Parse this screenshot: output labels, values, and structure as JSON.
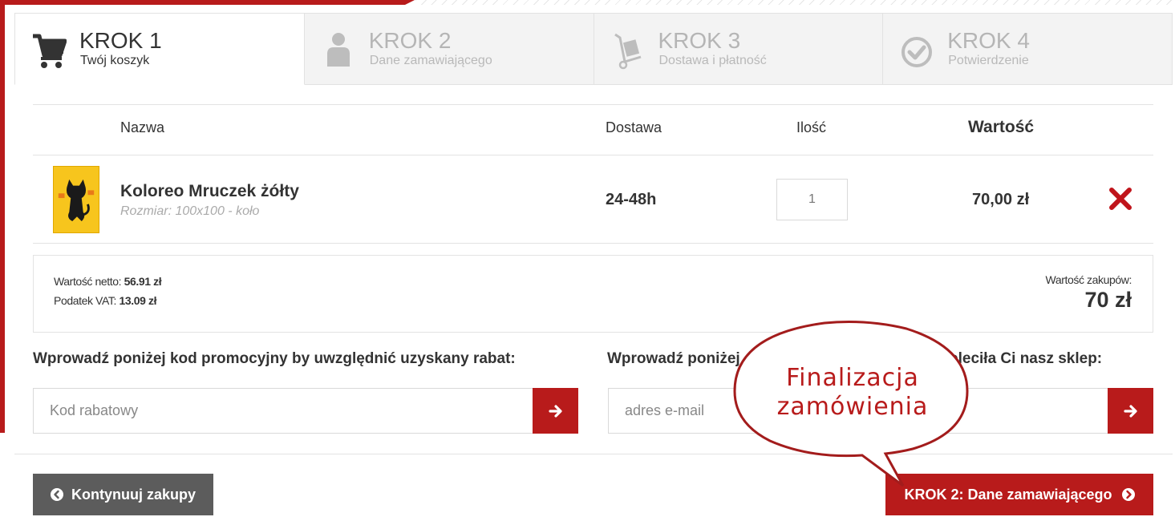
{
  "steps": [
    {
      "title": "KROK 1",
      "subtitle": "Twój koszyk",
      "icon": "cart-icon",
      "active": true
    },
    {
      "title": "KROK 2",
      "subtitle": "Dane zamawiającego",
      "icon": "user-icon",
      "active": false
    },
    {
      "title": "KROK 3",
      "subtitle": "Dostawa i płatność",
      "icon": "hand-truck-icon",
      "active": false
    },
    {
      "title": "KROK 4",
      "subtitle": "Potwierdzenie",
      "icon": "check-circle-icon",
      "active": false
    }
  ],
  "table": {
    "col_name": "Nazwa",
    "col_delivery": "Dostawa",
    "col_qty": "Ilość",
    "col_value": "Wartość"
  },
  "item": {
    "name": "Koloreo Mruczek żółty",
    "variant": "Rozmiar: 100x100 - koło",
    "delivery": "24-48h",
    "quantity": "1",
    "price": "70,00 zł"
  },
  "summary": {
    "net_label": "Wartość netto:",
    "net_value": "56.91 zł",
    "vat_label": "Podatek VAT:",
    "vat_value": "13.09 zł",
    "total_label": "Wartość zakupów:",
    "total_value": "70 zł"
  },
  "promo": {
    "label": "Wprowadź poniżej kod promocyjny by uwzględnić uzyskany rabat:",
    "placeholder": "Kod rabatowy"
  },
  "referral": {
    "label_start": "Wprowadź poniżej",
    "label_end": "oleciła Ci nasz sklep:",
    "placeholder": "adres e-mail"
  },
  "buttons": {
    "continue": "Kontynuuj zakupy",
    "next": "KROK 2: Dane zamawiającego"
  },
  "callout": {
    "line1": "Finalizacja",
    "line2": "zamówienia"
  },
  "colors": {
    "accent": "#b81b1b",
    "dark_button": "#5c5c5c",
    "product_yellow": "#f7c51d"
  }
}
